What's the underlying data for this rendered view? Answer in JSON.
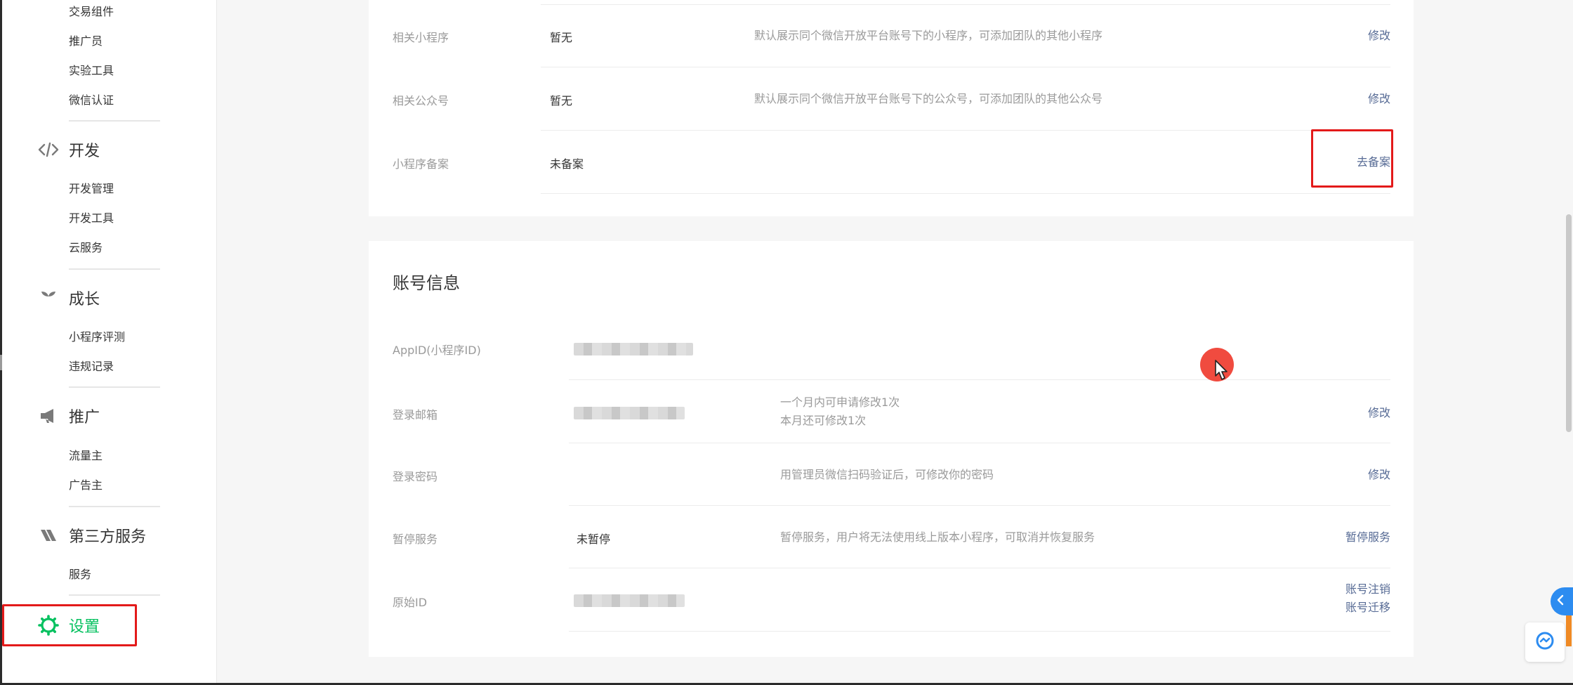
{
  "sidebar": {
    "items": [
      {
        "label": "交易组件"
      },
      {
        "label": "推广员"
      },
      {
        "label": "实验工具"
      },
      {
        "label": "微信认证"
      },
      {
        "label": "开发管理"
      },
      {
        "label": "开发工具"
      },
      {
        "label": "云服务"
      },
      {
        "label": "小程序评测"
      },
      {
        "label": "违规记录"
      },
      {
        "label": "流量主"
      },
      {
        "label": "广告主"
      },
      {
        "label": "服务"
      }
    ],
    "sections": [
      {
        "label": "开发",
        "icon": "code-icon"
      },
      {
        "label": "成长",
        "icon": "sprout-icon"
      },
      {
        "label": "推广",
        "icon": "megaphone-icon"
      },
      {
        "label": "第三方服务",
        "icon": "third-party-icon"
      },
      {
        "label": "设置",
        "icon": "settings-gear-icon",
        "active": true
      }
    ]
  },
  "basic_info": {
    "rows": [
      {
        "label": "相关小程序",
        "value": "暂无",
        "desc": "默认展示同个微信开放平台账号下的小程序，可添加团队的其他小程序",
        "action": "修改"
      },
      {
        "label": "相关公众号",
        "value": "暂无",
        "desc": "默认展示同个微信开放平台账号下的公众号，可添加团队的其他公众号",
        "action": "修改"
      },
      {
        "label": "小程序备案",
        "value": "未备案",
        "desc": "",
        "action": "去备案"
      }
    ]
  },
  "account_info": {
    "title": "账号信息",
    "rows": [
      {
        "label": "AppID(小程序ID)",
        "value_redacted": true
      },
      {
        "label": "登录邮箱",
        "value_redacted": true,
        "desc_line1": "一个月内可申请修改1次",
        "desc_line2": "本月还可修改1次",
        "action": "修改"
      },
      {
        "label": "登录密码",
        "desc": "用管理员微信扫码验证后，可修改你的密码",
        "action": "修改"
      },
      {
        "label": "暂停服务",
        "value": "未暂停",
        "desc": "暂停服务，用户将无法使用线上版本小程序，可取消并恢复服务",
        "action": "暂停服务"
      },
      {
        "label": "原始ID",
        "value_redacted": true,
        "action_line1": "账号注销",
        "action_line2": "账号迁移"
      }
    ]
  },
  "colors": {
    "accent_green": "#07c160",
    "link_blue": "#576b95",
    "highlight_red": "#e31a1a",
    "cursor_dot": "#f04b3f"
  }
}
